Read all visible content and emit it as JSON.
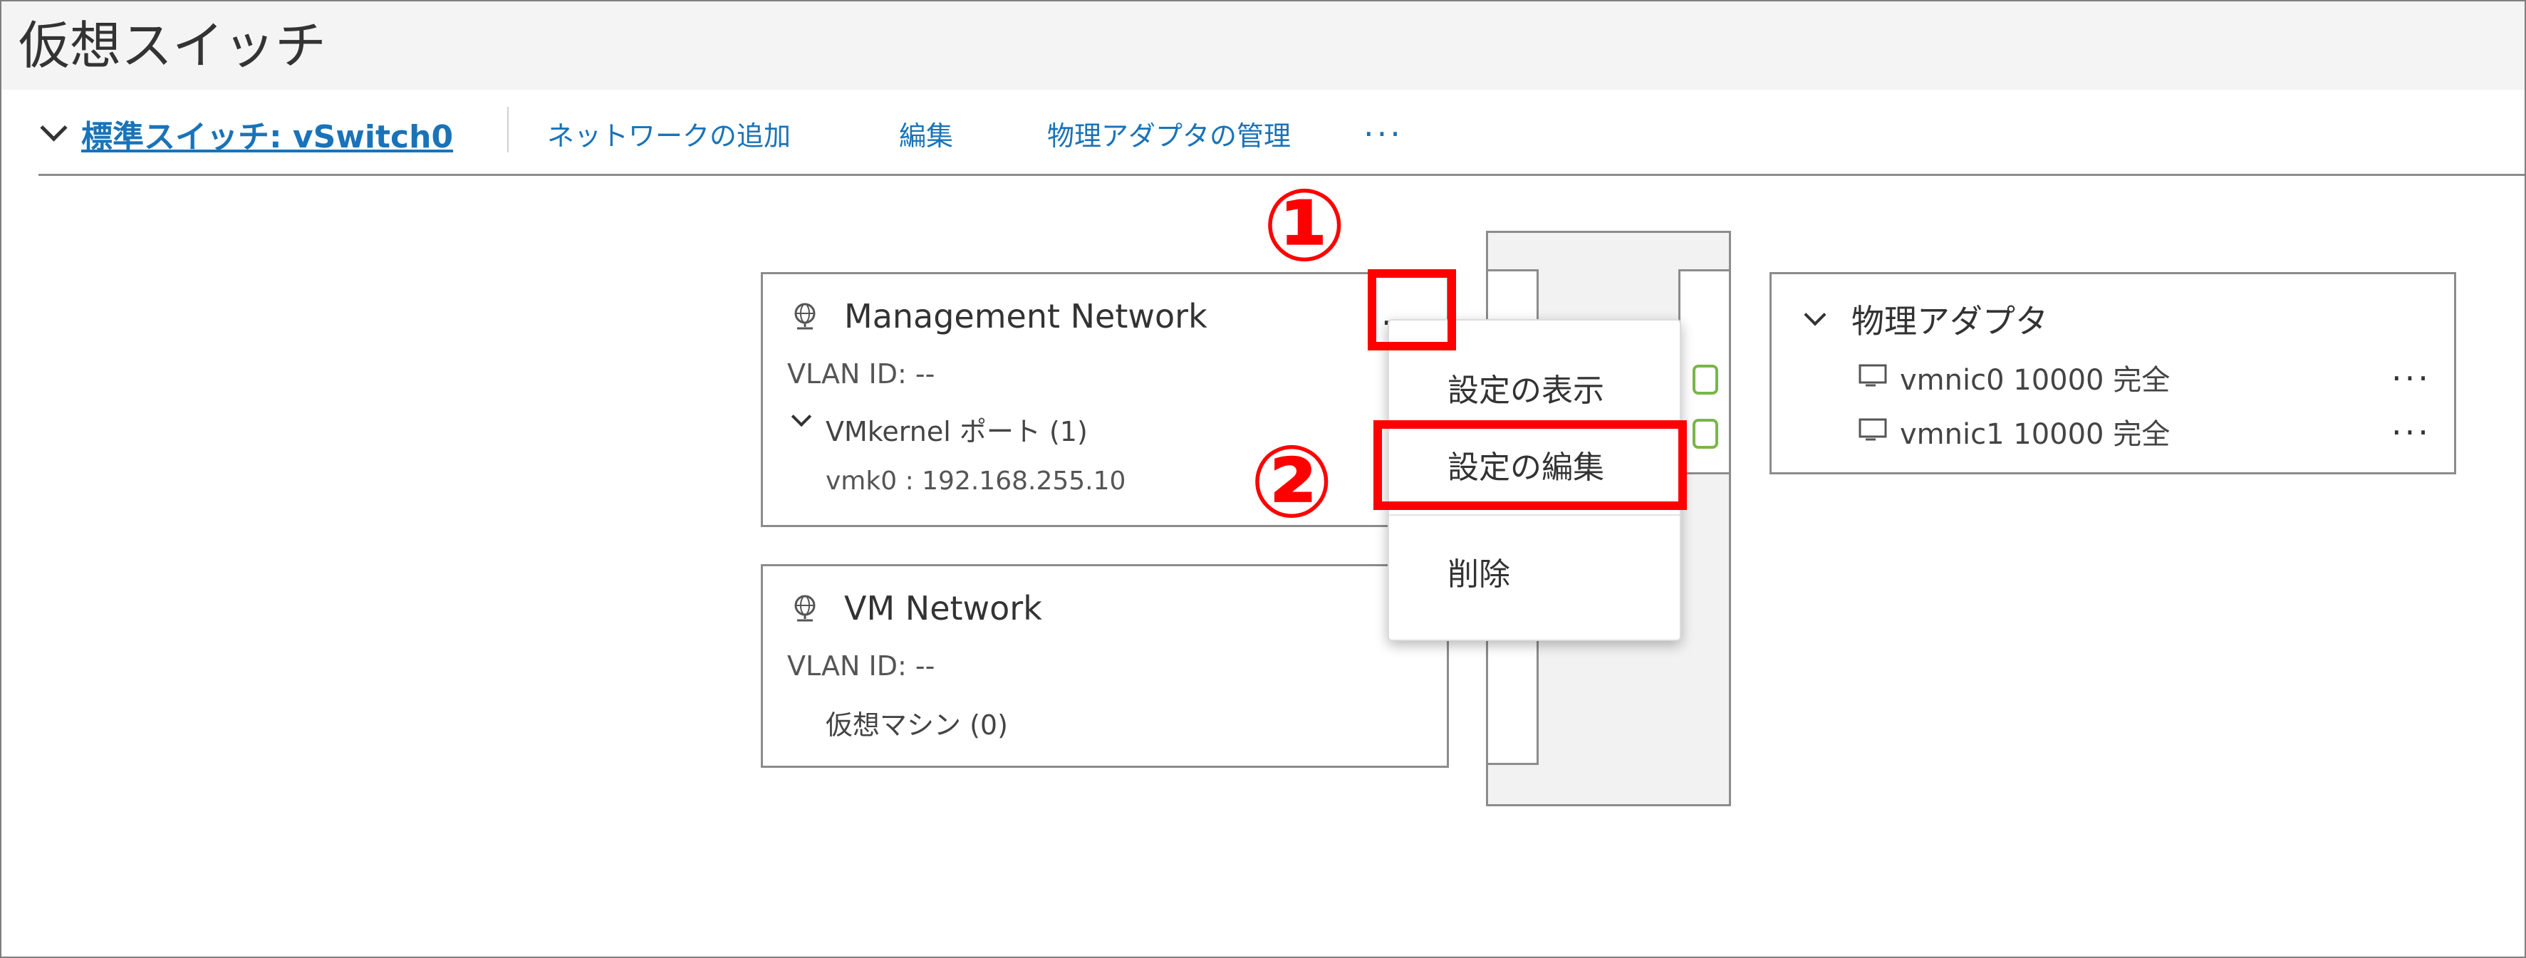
{
  "page_title": "仮想スイッチ",
  "toolbar": {
    "switch_link": "標準スイッチ: vSwitch0",
    "add_network": "ネットワークの追加",
    "edit": "編集",
    "manage_adapters": "物理アダプタの管理",
    "more": "..."
  },
  "port_groups": [
    {
      "name": "Management Network",
      "vlan": "VLAN ID: --",
      "sub_header": "VMkernel ポート (1)",
      "detail": "vmk0 : 192.168.255.10",
      "more": "..."
    },
    {
      "name": "VM Network",
      "vlan": "VLAN ID: --",
      "detail": "仮想マシン (0)"
    }
  ],
  "context_menu": {
    "items": [
      "設定の表示",
      "設定の編集",
      "削除"
    ]
  },
  "physical_adapters": {
    "title": "物理アダプタ",
    "items": [
      {
        "label": "vmnic0 10000 完全",
        "more": "..."
      },
      {
        "label": "vmnic1 10000 完全",
        "more": "..."
      }
    ]
  },
  "annotations": {
    "step1": "①",
    "step2": "②"
  },
  "colors": {
    "link": "#1a73b8",
    "highlight": "#ff0000",
    "uplink": "#7ab648",
    "border": "#8c8c8c"
  }
}
